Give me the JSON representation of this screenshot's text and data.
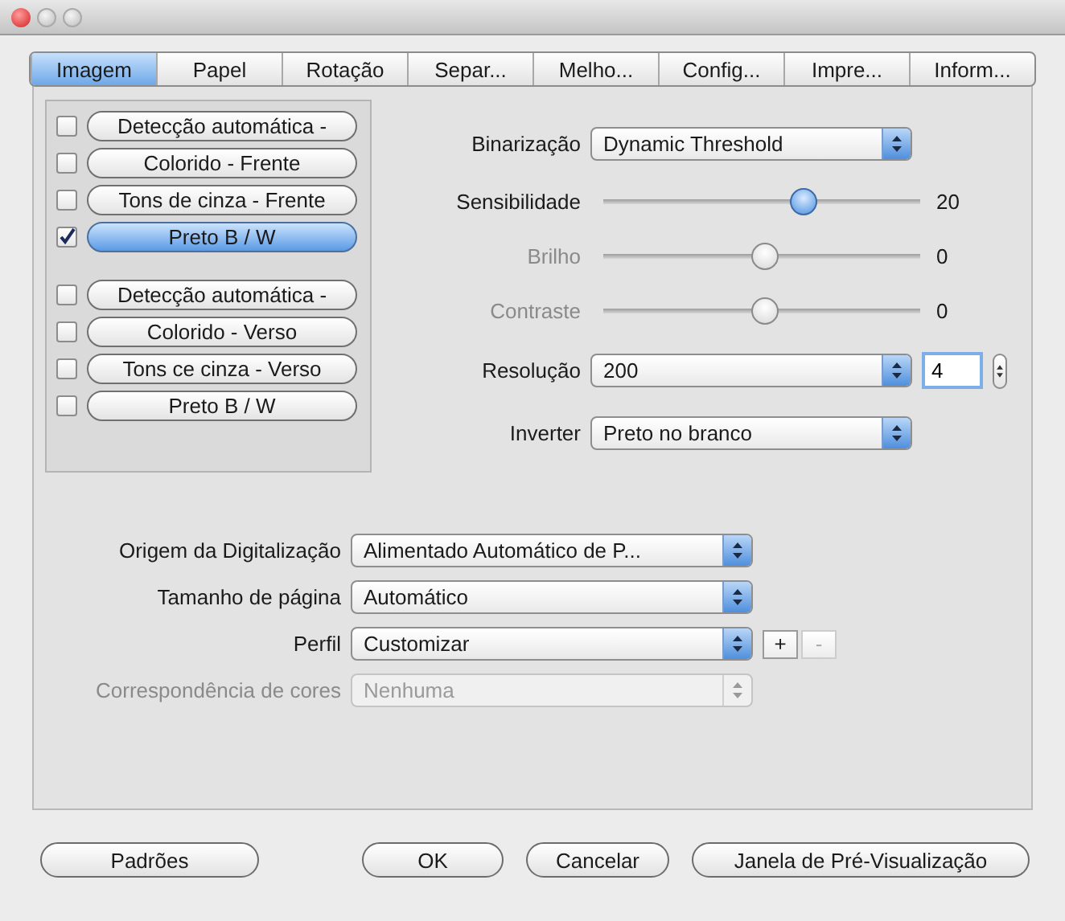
{
  "tabs": [
    {
      "label": "Imagem",
      "selected": true
    },
    {
      "label": "Papel",
      "selected": false
    },
    {
      "label": "Rotação",
      "selected": false
    },
    {
      "label": "Separ...",
      "selected": false
    },
    {
      "label": "Melho...",
      "selected": false
    },
    {
      "label": "Config...",
      "selected": false
    },
    {
      "label": "Impre...",
      "selected": false
    },
    {
      "label": "Inform...",
      "selected": false
    }
  ],
  "mode_groups": [
    [
      {
        "label": "Detecção automática -",
        "checked": false
      },
      {
        "label": "Colorido - Frente",
        "checked": false
      },
      {
        "label": "Tons de cinza - Frente",
        "checked": false
      },
      {
        "label": "Preto B / W",
        "checked": true
      }
    ],
    [
      {
        "label": "Detecção automática -",
        "checked": false
      },
      {
        "label": "Colorido - Verso",
        "checked": false
      },
      {
        "label": "Tons ce cinza - Verso",
        "checked": false
      },
      {
        "label": "Preto B / W",
        "checked": false
      }
    ]
  ],
  "image_settings": [
    {
      "kind": "select",
      "label": "Binarização",
      "value": "Dynamic Threshold"
    },
    {
      "kind": "slider",
      "label": "Sensibilidade",
      "level": 0.63,
      "reading": "20",
      "disabled": false
    },
    {
      "kind": "slider",
      "label": "Brilho",
      "level": 0.51,
      "reading": "0",
      "disabled": true
    },
    {
      "kind": "slider",
      "label": "Contraste",
      "level": 0.51,
      "reading": "0",
      "disabled": true
    },
    {
      "kind": "select",
      "label": "Resolução",
      "value": "200",
      "spinner_value": "4"
    },
    {
      "kind": "select",
      "label": "Inverter",
      "value": "Preto no branco"
    }
  ],
  "scan_settings": [
    {
      "label": "Origem da Digitalização",
      "value": "Alimentado Automático de P...",
      "disabled": false
    },
    {
      "label": "Tamanho de página",
      "value": "Automático",
      "disabled": false
    },
    {
      "label": "Perfil",
      "value": "Customizar",
      "disabled": false,
      "profile_buttons": [
        {
          "label": "+",
          "disabled": false
        },
        {
          "label": "-",
          "disabled": true
        }
      ]
    },
    {
      "label": "Correspondência de cores",
      "value": "Nenhuma",
      "disabled": true
    }
  ],
  "buttons": [
    {
      "label": "Padrões"
    },
    {
      "label": "OK"
    },
    {
      "label": "Cancelar"
    },
    {
      "label": "Janela de Pré-Visualização"
    }
  ]
}
